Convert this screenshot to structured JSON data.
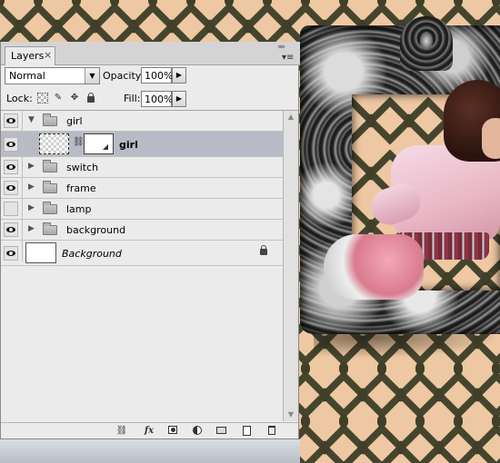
{
  "panel": {
    "tab_label": "Layers",
    "tab_close": "×",
    "collapse_glyph": "»»",
    "menu_glyph": "▾≡"
  },
  "blend": {
    "mode": "Normal",
    "opacity_label": "Opacity:",
    "opacity_value": "100%"
  },
  "lock": {
    "label": "Lock:",
    "fill_label": "Fill:",
    "fill_value": "100%"
  },
  "layers": [
    {
      "name": "girl",
      "type": "group",
      "expanded": true,
      "visible": true
    },
    {
      "name": "girl",
      "type": "layer-with-mask",
      "visible": true,
      "selected": true
    },
    {
      "name": "switch",
      "type": "group",
      "expanded": false,
      "visible": true
    },
    {
      "name": "frame",
      "type": "group",
      "expanded": false,
      "visible": true
    },
    {
      "name": "lamp",
      "type": "group",
      "expanded": false,
      "visible": false
    },
    {
      "name": "background",
      "type": "group",
      "expanded": false,
      "visible": true
    },
    {
      "name": "Background",
      "type": "background",
      "visible": true,
      "locked": true
    }
  ],
  "footer_icons": [
    "link-icon",
    "fx-icon",
    "mask-icon",
    "adjustment-icon",
    "group-icon",
    "new-layer-icon",
    "delete-icon"
  ],
  "footer": {
    "fx": "fx"
  },
  "colors": {
    "panel_bg": "#ebebeb",
    "selected_row": "#b8bbc6",
    "wallpaper_light": "#eec8a2",
    "wallpaper_dark": "#3f3f2a"
  }
}
